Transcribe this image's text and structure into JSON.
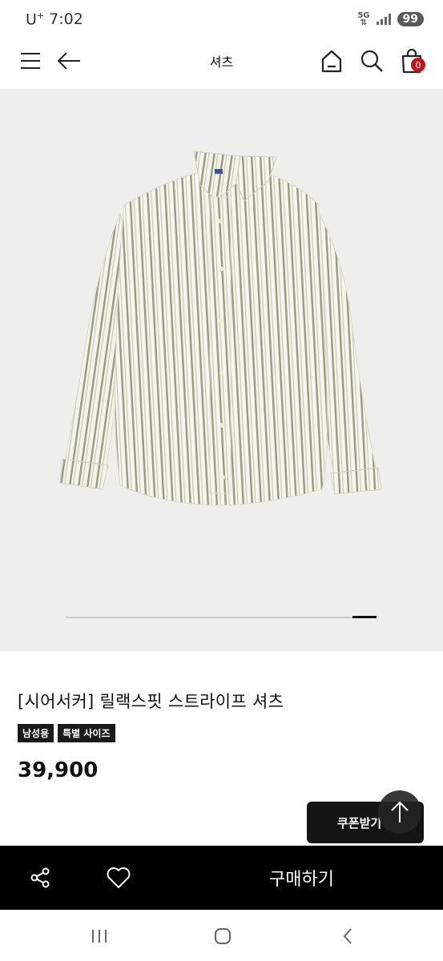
{
  "status_bar": {
    "carrier": "U",
    "carrier_sup": "+",
    "time": "7:02",
    "network": "5G",
    "battery": "99"
  },
  "nav": {
    "title": "셔츠",
    "cart_count": "0",
    "icons": [
      "menu-icon",
      "back-arrow-icon",
      "home-icon",
      "search-icon",
      "shopping-bag-icon"
    ]
  },
  "gallery": {
    "image_description_icon": "striped-shirt-photo",
    "active_slide_progress": 0.92
  },
  "product": {
    "title": "[시어서커] 릴랙스핏 스트라이프 셔츠",
    "tags": [
      "남성용",
      "특별 사이즈"
    ],
    "price": "39,900"
  },
  "floating": {
    "coupon_label": "쿠폰받기"
  },
  "bottom_bar": {
    "buy_label": "구매하기",
    "icons": [
      "share-icon",
      "heart-icon"
    ]
  },
  "colors": {
    "accent_badge": "#c0141b",
    "bar_bg": "#000000",
    "hero_bg": "#eeeeec"
  }
}
